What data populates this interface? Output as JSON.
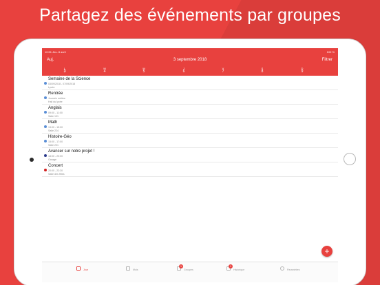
{
  "headline": "Partagez des événements par groupes",
  "status_bar": {
    "time": "10:51  Jeu. 8 avril",
    "battery": "100 %"
  },
  "nav": {
    "today_label": "Auj.",
    "title": "3 septembre 2018",
    "filter_label": "Filtrer"
  },
  "week": {
    "days": [
      {
        "letter": "L",
        "num": "3",
        "selected": true
      },
      {
        "letter": "M",
        "num": "4",
        "selected": false
      },
      {
        "letter": "M",
        "num": "5",
        "selected": false
      },
      {
        "letter": "J",
        "num": "6",
        "selected": false
      },
      {
        "letter": "V",
        "num": "7",
        "selected": false
      },
      {
        "letter": "S",
        "num": "8",
        "selected": false
      },
      {
        "letter": "D",
        "num": "9",
        "selected": false
      }
    ]
  },
  "events": [
    {
      "title": "Semaine de la Science",
      "time": "03/09/2018 - 07/09/2018",
      "place": "Lycée",
      "color": "#5b8fd6"
    },
    {
      "title": "Rentrée",
      "time": "Journée entière",
      "place": "Hall du lycée",
      "color": "#5b8fd6"
    },
    {
      "title": "Anglais",
      "time": "09:00 - 11:00",
      "place": "Salle 101",
      "color": "#5b8fd6"
    },
    {
      "title": "Math",
      "time": "13:00 - 15:00",
      "place": "Salle 224",
      "color": "#5b8fd6"
    },
    {
      "title": "Histoire-Géo",
      "time": "15:00 - 17:00",
      "place": "Salle 201",
      "color": "#5b8fd6"
    },
    {
      "title": "Avancer sur notre projet !",
      "time": "18:00 - 20:00",
      "place": "Garage",
      "color": "#2b3a8c"
    },
    {
      "title": "Concert",
      "time": "20:00 - 22:30",
      "place": "Salle des fêtes",
      "color": "#d22020"
    }
  ],
  "fab_label": "+",
  "tabs": [
    {
      "label": "Jour",
      "active": true,
      "badge": ""
    },
    {
      "label": "Mois",
      "active": false,
      "badge": ""
    },
    {
      "label": "Groupes",
      "active": false,
      "badge": "1"
    },
    {
      "label": "Historique",
      "active": false,
      "badge": "1"
    },
    {
      "label": "Paramètres",
      "active": false,
      "badge": ""
    }
  ],
  "colors": {
    "accent": "#e8413e"
  }
}
